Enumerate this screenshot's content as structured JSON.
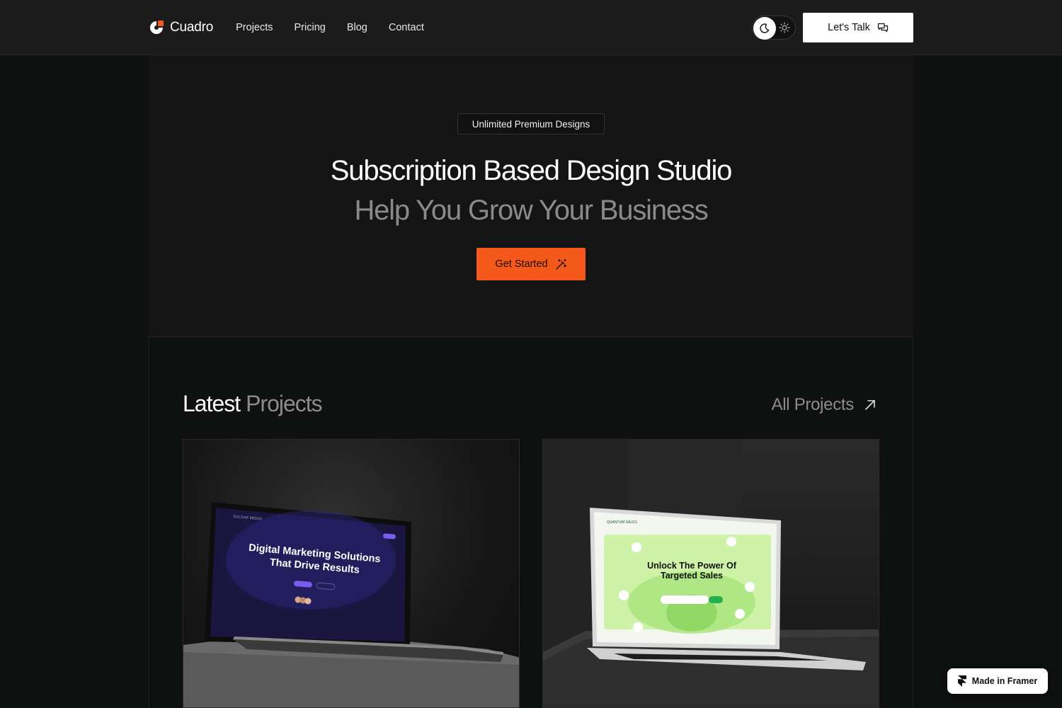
{
  "header": {
    "brand": "Cuadro",
    "nav": [
      "Projects",
      "Pricing",
      "Blog",
      "Contact"
    ],
    "cta_label": "Let's Talk"
  },
  "hero": {
    "badge": "Unlimited Premium Designs",
    "title": "Subscription Based Design Studio",
    "subtitle": "Help You Grow Your Business",
    "cta_label": "Get Started"
  },
  "projects": {
    "title_white": "Latest",
    "title_gray": "Projects",
    "all_link": "All Projects",
    "cards": [
      {
        "screen_brand": "SULSAR MEDIA",
        "screen_headline_1": "Digital Marketing Solutions",
        "screen_headline_2": "That Drive Results"
      },
      {
        "screen_brand": "QUANTUM SALES",
        "screen_headline_1": "Unlock The Power Of",
        "screen_headline_2": "Targeted Sales"
      }
    ]
  },
  "framer_badge": "Made in Framer",
  "colors": {
    "accent": "#f4581a",
    "background": "#0f1010",
    "header_bg": "#1b1b1b",
    "muted_text": "#8a8a8a"
  },
  "icons": {
    "logo": "cuadro-logo-icon",
    "moon": "moon-icon",
    "sun": "sun-icon",
    "chat": "chat-bubbles-icon",
    "wand": "magic-wand-icon",
    "arrow": "arrow-up-right-icon",
    "framer": "framer-logo-icon"
  }
}
